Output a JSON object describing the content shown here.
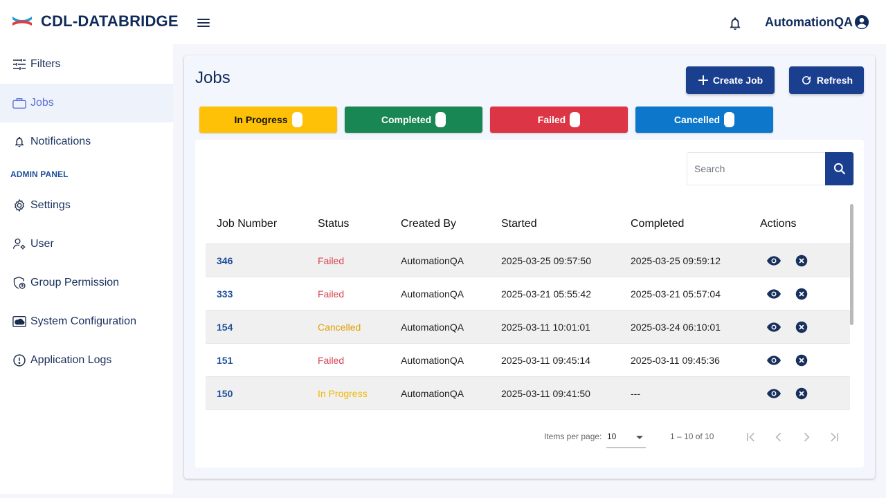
{
  "header": {
    "brand": "CDL-DATABRIDGE",
    "user": "AutomationQA"
  },
  "sidebar": {
    "items": [
      {
        "label": "Filters",
        "icon": "sliders-icon"
      },
      {
        "label": "Jobs",
        "icon": "briefcase-icon",
        "active": true
      },
      {
        "label": "Notifications",
        "icon": "bell-icon"
      }
    ],
    "admin_label": "ADMIN PANEL",
    "admin_items": [
      {
        "label": "Settings",
        "icon": "gear-icon"
      },
      {
        "label": "User",
        "icon": "user-gear-icon"
      },
      {
        "label": "Group Permission",
        "icon": "shield-icon"
      },
      {
        "label": "System Configuration",
        "icon": "cloud-icon"
      },
      {
        "label": "Application Logs",
        "icon": "alert-circle-icon"
      }
    ]
  },
  "main": {
    "title": "Jobs",
    "create_label": "Create Job",
    "refresh_label": "Refresh",
    "status_chips": [
      {
        "label": "In Progress",
        "color": "#ffc107",
        "text_color": "#111111"
      },
      {
        "label": "Completed",
        "color": "#198754",
        "text_color": "#ffffff"
      },
      {
        "label": "Failed",
        "color": "#dc3545",
        "text_color": "#ffffff"
      },
      {
        "label": "Cancelled",
        "color": "#0d77cc",
        "text_color": "#ffffff"
      }
    ],
    "search": {
      "placeholder": "Search"
    },
    "table": {
      "columns": [
        "Job Number",
        "Status",
        "Created By",
        "Started",
        "Completed",
        "Actions"
      ],
      "rows": [
        {
          "job": "346",
          "status": "Failed",
          "created_by": "AutomationQA",
          "started": "2025-03-25 09:57:50",
          "completed": "2025-03-25 09:59:12"
        },
        {
          "job": "333",
          "status": "Failed",
          "created_by": "AutomationQA",
          "started": "2025-03-21 05:55:42",
          "completed": "2025-03-21 05:57:04"
        },
        {
          "job": "154",
          "status": "Cancelled",
          "created_by": "AutomationQA",
          "started": "2025-03-11 10:01:01",
          "completed": "2025-03-24 06:10:01"
        },
        {
          "job": "151",
          "status": "Failed",
          "created_by": "AutomationQA",
          "started": "2025-03-11 09:45:14",
          "completed": "2025-03-11 09:45:36"
        },
        {
          "job": "150",
          "status": "In Progress",
          "created_by": "AutomationQA",
          "started": "2025-03-11 09:41:50",
          "completed": "---"
        }
      ]
    },
    "paginator": {
      "items_per_page_label": "Items per page:",
      "items_per_page": "10",
      "range": "1 – 10 of 10"
    }
  },
  "colors": {
    "status_failed": "#d9434f",
    "status_cancelled": "#e0a000",
    "status_in_progress": "#f2b600",
    "primary": "#1a3f8f"
  }
}
